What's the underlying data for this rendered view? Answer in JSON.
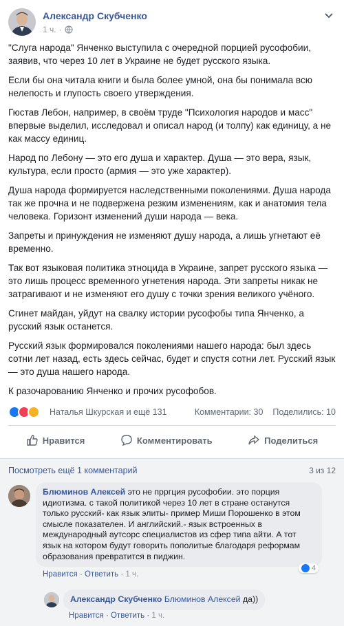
{
  "post": {
    "author": "Александр Скубченко",
    "time": "1 ч.",
    "paragraphs": [
      "\"Слуга народа\" Янченко выступила с очередной порцией русофобии, заявив, что через 10 лет в Украине не будет русского языка.",
      "Если бы она читала книги и была более умной, она бы понимала всю нелепость и глупость своего утверждения.",
      "Гюстав Лебон, например, в своём труде \"Психология народов и масс\" впервые выделил, исследовал и описал народ (и толпу) как единицу, а не как массу единиц.",
      "Народ по Лебону — это его душа и характер. Душа — это вера, язык, культура, если просто (армия — это уже характер).",
      "Душа народа формируется наследственными поколениями. Душа народа так же прочна и не подвержена резким изменениям, как и анатомия тела человека. Горизонт изменений души народа — века.",
      "Запреты и принуждения не изменяют душу народа, а лишь угнетают её временно.",
      "Так вот языковая политика этноцида в Украине, запрет русского языка — это лишь процесс временного угнетения народа. Эти запреты никак не затрагивают и не изменяют его душу с точки зрения великого учёного.",
      "Сгинет майдан, уйдут на свалку истории русофобы типа Янченко, а русский язык останется.",
      "Русский язык формировался поколениями нашего народа: был здесь сотни лет назад, есть здесь сейчас, будет и спустя сотни лет. Русский язык — это душа нашего народа.",
      "К разочарованию Янченко и прочих русофобов."
    ]
  },
  "reactions": {
    "names": "Наталья Шкурская и ещё 131",
    "comments": "Комментарии: 30",
    "shares": "Поделились: 10"
  },
  "actions": {
    "like": "Нравится",
    "comment": "Комментировать",
    "share": "Поделиться"
  },
  "comments_header": {
    "more": "Посмотреть ещё 1 комментарий",
    "pager": "3 из 12"
  },
  "comment1": {
    "name": "Блюминов Алексей",
    "text": "это не прргция русофобии. это порция идиотизма. с такой политикой через 10 лет в стране останутся только русский- как язык элиты- пример Миши Порошенко в этом смысле показателен. И английский.- язык встроенных в международный аутсорс специалистов из сфер типа айти. А тот язык на котором будут говорить пополитые благодаря реформам образования превратится в пиджин.",
    "like": "Нравится",
    "reply": "Ответить",
    "time": "1 ч.",
    "reaction_count": "4"
  },
  "comment2": {
    "name": "Александр Скубченко",
    "mention": "Блюминов Алексей",
    "text": "да))",
    "like": "Нравится",
    "reply": "Ответить",
    "time": "1 ч."
  },
  "colors": {
    "link": "#385898",
    "like": "#1877f2",
    "love": "#f33e58",
    "sad": "#f7b125"
  }
}
